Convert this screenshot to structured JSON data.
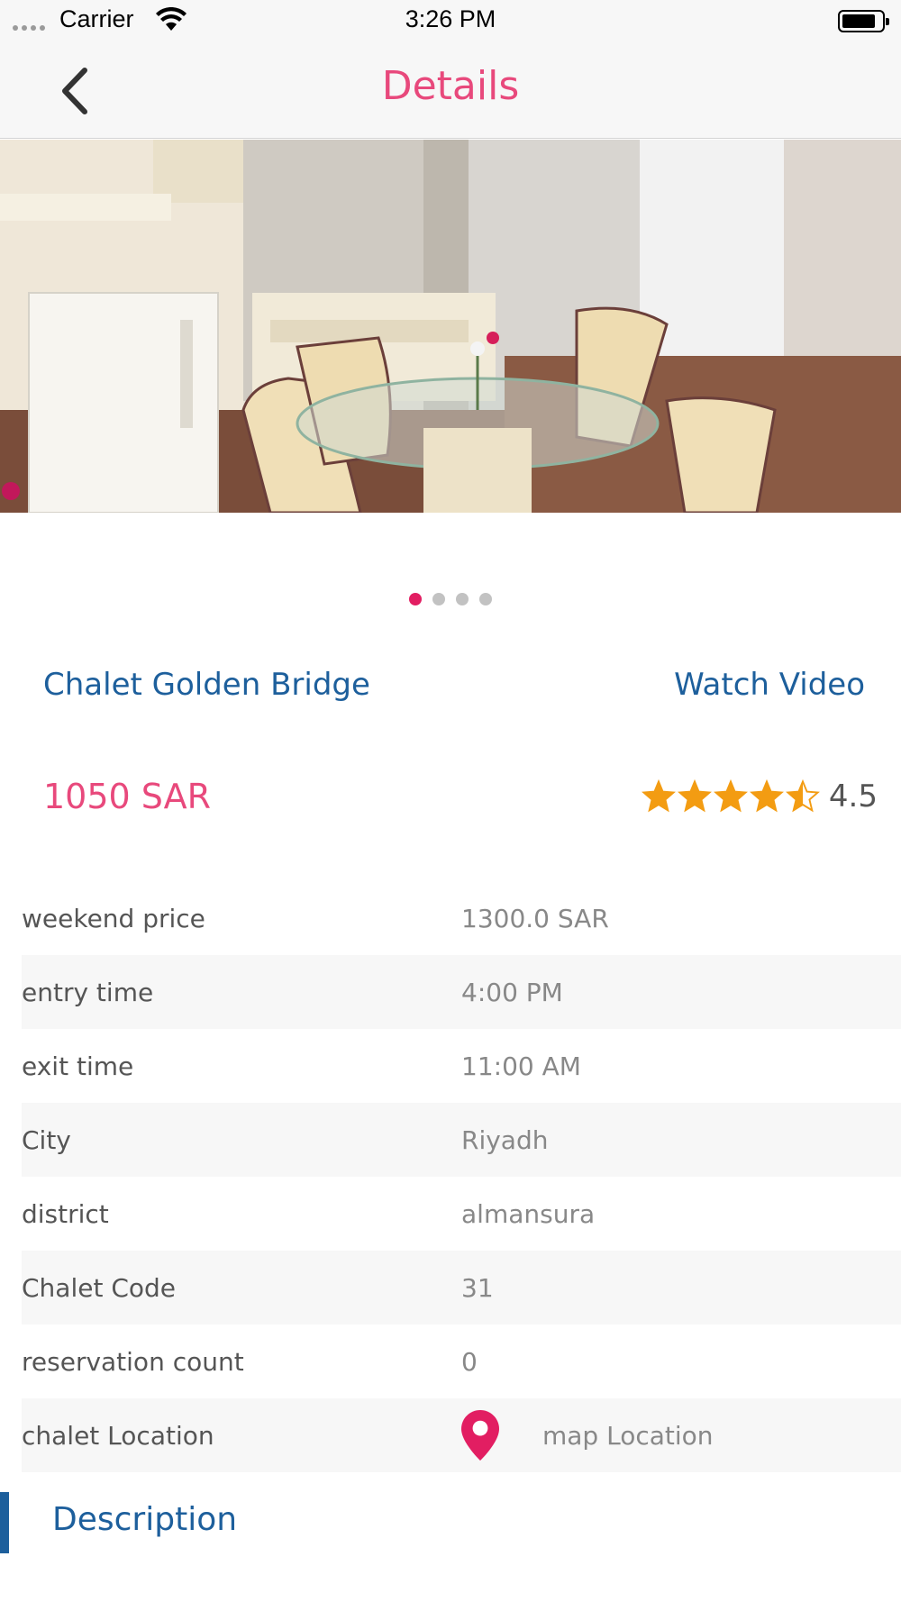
{
  "status_bar": {
    "carrier": "Carrier",
    "time": "3:26 PM"
  },
  "nav": {
    "title": "Details",
    "back_icon": "chevron-left-icon"
  },
  "gallery": {
    "page_count": 4,
    "active_page": 1
  },
  "chalet": {
    "name": "Chalet Golden Bridge",
    "watch_video": "Watch Video",
    "price": "1050 SAR",
    "rating_value": "4.5",
    "rating": 4.5
  },
  "details": [
    {
      "label": "weekend price",
      "value": "1300.0 SAR"
    },
    {
      "label": "entry time",
      "value": "4:00 PM"
    },
    {
      "label": "exit time",
      "value": "11:00 AM"
    },
    {
      "label": "City",
      "value": "Riyadh"
    },
    {
      "label": "district",
      "value": "almansura"
    },
    {
      "label": "Chalet Code",
      "value": "31"
    },
    {
      "label": "reservation count",
      "value": "0"
    },
    {
      "label": "chalet Location",
      "value": "map Location"
    }
  ],
  "description": {
    "heading": "Description"
  },
  "colors": {
    "accent_pink": "#e8497c",
    "brand_blue": "#1d5f9c",
    "star_orange": "#f39c12",
    "pager_active": "#e21e62"
  }
}
